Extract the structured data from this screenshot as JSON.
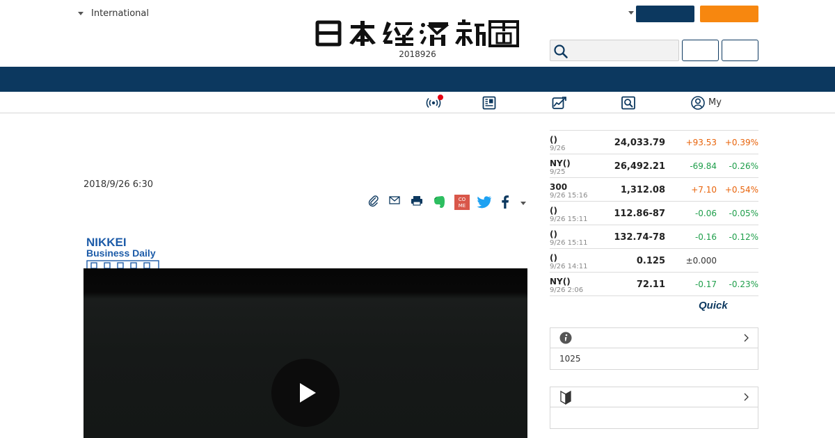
{
  "header": {
    "edition_label": "International",
    "date_line": "2018926"
  },
  "subnav": {
    "items": [
      {
        "icon": "live-broadcast-icon",
        "label": ""
      },
      {
        "icon": "newspaper-icon",
        "label": ""
      },
      {
        "icon": "market-chart-icon",
        "label": ""
      },
      {
        "icon": "search-article-icon",
        "label": ""
      },
      {
        "icon": "user-icon",
        "label": "My"
      }
    ]
  },
  "article": {
    "date": "2018/9/26 6:30",
    "share_icons": [
      "clip-icon",
      "mail-icon",
      "print-icon",
      "evernote-icon",
      "comemo-icon",
      "twitter-icon",
      "facebook-icon",
      "more-caret-icon"
    ],
    "video_source_logo": [
      "NIKKEI",
      "Business Daily"
    ]
  },
  "markets": {
    "rows": [
      {
        "name": "()",
        "time": "9/26",
        "value": "24,033.79",
        "change": "+93.53",
        "pct": "+0.39%",
        "dir": "up"
      },
      {
        "name": "NY()",
        "time": "9/25",
        "value": "26,492.21",
        "change": "-69.84",
        "pct": "-0.26%",
        "dir": "down"
      },
      {
        "name": "300",
        "time": "9/26 15:16",
        "value": "1,312.08",
        "change": "+7.10",
        "pct": "+0.54%",
        "dir": "up"
      },
      {
        "name": "()",
        "time": "9/26 15:11",
        "value": "112.86-87",
        "change": "-0.06",
        "pct": "-0.05%",
        "dir": "down"
      },
      {
        "name": "()",
        "time": "9/26 15:11",
        "value": "132.74-78",
        "change": "-0.16",
        "pct": "-0.12%",
        "dir": "down"
      },
      {
        "name": "()",
        "time": "9/26 14:11",
        "value": "0.125",
        "change": "±0.000",
        "pct": "",
        "dir": "flat"
      },
      {
        "name": "NY()",
        "time": "9/26 2:06",
        "value": "72.11",
        "change": "-0.17",
        "pct": "-0.23%",
        "dir": "down"
      }
    ],
    "provider_logo": "Quick"
  },
  "side_boxes": [
    {
      "icon": "info-icon",
      "body": "1025"
    },
    {
      "icon": "beginner-mark-icon",
      "body": ""
    }
  ],
  "colors": {
    "brand_navy": "#0c385f",
    "accent_orange": "#f7870f",
    "price_up": "#e8630a",
    "price_down": "#1e9e4a",
    "alert_red": "#e60012"
  }
}
